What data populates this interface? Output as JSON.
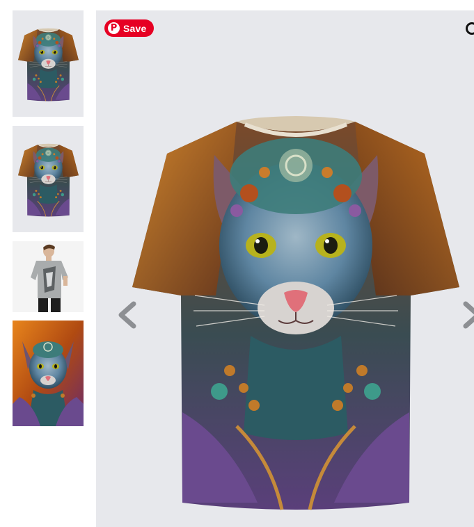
{
  "pinterest": {
    "save_label": "Save",
    "logo_letter": "P",
    "brand_color": "#e60023"
  },
  "thumbnails": [
    {
      "name": "front-view"
    },
    {
      "name": "back-view"
    },
    {
      "name": "model-view"
    },
    {
      "name": "artwork-view"
    }
  ],
  "colors": {
    "viewer_background": "#e7e8ec",
    "shirt_orange": "#c0621a",
    "shirt_purple": "#6a4a8e",
    "cat_blue": "#5f86a2",
    "eye_yellow": "#b7b21d",
    "nose_pink": "#e0707a"
  },
  "icons": {
    "prev": "chevron-left-icon",
    "next": "chevron-right-icon",
    "pinterest": "pinterest-icon"
  }
}
